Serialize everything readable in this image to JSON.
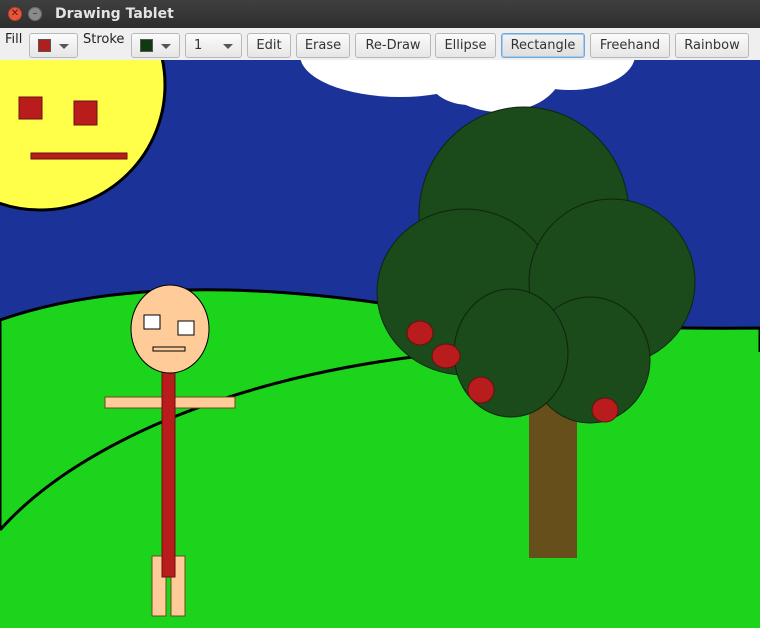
{
  "window": {
    "title": "Drawing Tablet"
  },
  "toolbar": {
    "fill_label": "Fill",
    "stroke_label": "Stroke",
    "fill_color": "#b01e1e",
    "stroke_color": "#0e3a0e",
    "stroke_width": "1",
    "buttons": {
      "edit": "Edit",
      "erase": "Erase",
      "redraw": "Re-Draw",
      "ellipse": "Ellipse",
      "rectangle": "Rectangle",
      "freehand": "Freehand",
      "rainbow": "Rainbow"
    },
    "active_tool": "Rectangle"
  },
  "colors": {
    "sky": "#1b3399",
    "grass": "#1bd41b",
    "sun": "#ffff4a",
    "leaves": "#1b4a1b",
    "trunk": "#664f1b",
    "apple": "#b81c1c",
    "skin": "#ffcc99",
    "body": "#b81c1c",
    "cloud": "#ffffff"
  },
  "icons": {
    "close": "close-icon",
    "minimize": "minimize-icon",
    "dropdown": "chevron-down-icon"
  }
}
